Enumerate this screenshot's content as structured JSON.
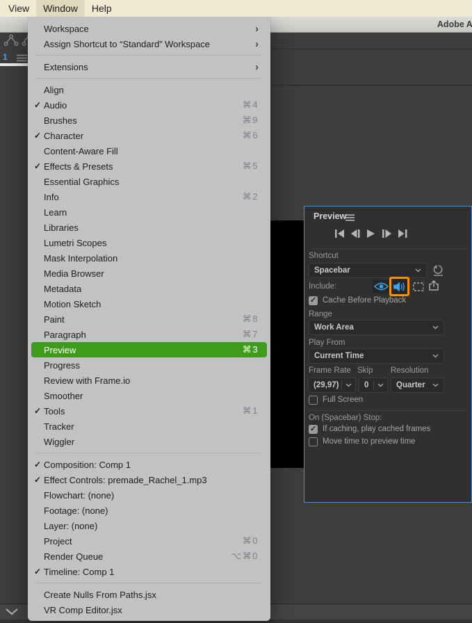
{
  "colors": {
    "menu_highlight_green": "#3f9c1a",
    "accent_blue": "#3ba1e8",
    "include_highlight_orange": "#f79400",
    "panel_border_blue": "#4590d8",
    "menubar_cream": "#f0ead2"
  },
  "menubar": {
    "items": [
      {
        "label": "View"
      },
      {
        "label": "Window",
        "active": true
      },
      {
        "label": "Help"
      }
    ]
  },
  "titlebar": {
    "title": "Adobe Af"
  },
  "background": {
    "timeline_tab_number": "1"
  },
  "window_menu": {
    "items": [
      {
        "label": "Workspace",
        "submenu": true
      },
      {
        "label": "Assign Shortcut to “Standard” Workspace",
        "submenu": true
      },
      {
        "separator": true
      },
      {
        "label": "Extensions",
        "submenu": true
      },
      {
        "separator": true
      },
      {
        "label": "Align"
      },
      {
        "label": "Audio",
        "checked": true,
        "shortcut": "⌘4"
      },
      {
        "label": "Brushes",
        "shortcut": "⌘9"
      },
      {
        "label": "Character",
        "checked": true,
        "shortcut": "⌘6"
      },
      {
        "label": "Content-Aware Fill"
      },
      {
        "label": "Effects & Presets",
        "checked": true,
        "shortcut": "⌘5"
      },
      {
        "label": "Essential Graphics"
      },
      {
        "label": "Info",
        "shortcut": "⌘2"
      },
      {
        "label": "Learn"
      },
      {
        "label": "Libraries"
      },
      {
        "label": "Lumetri Scopes"
      },
      {
        "label": "Mask Interpolation"
      },
      {
        "label": "Media Browser"
      },
      {
        "label": "Metadata"
      },
      {
        "label": "Motion Sketch"
      },
      {
        "label": "Paint",
        "shortcut": "⌘8"
      },
      {
        "label": "Paragraph",
        "shortcut": "⌘7"
      },
      {
        "label": "Preview",
        "shortcut": "⌘3",
        "highlighted": true
      },
      {
        "label": "Progress"
      },
      {
        "label": "Review with Frame.io"
      },
      {
        "label": "Smoother"
      },
      {
        "label": "Tools",
        "checked": true,
        "shortcut": "⌘1"
      },
      {
        "label": "Tracker"
      },
      {
        "label": "Wiggler"
      },
      {
        "separator": true
      },
      {
        "label": "Composition: Comp 1",
        "checked": true
      },
      {
        "label": "Effect Controls: premade_Rachel_1.mp3",
        "checked": true
      },
      {
        "label": "Flowchart: (none)"
      },
      {
        "label": "Footage: (none)"
      },
      {
        "label": "Layer: (none)"
      },
      {
        "label": "Project",
        "shortcut": "⌘0"
      },
      {
        "label": "Render Queue",
        "shortcut": "⌥⌘0"
      },
      {
        "label": "Timeline: Comp 1",
        "checked": true
      },
      {
        "separator": true
      },
      {
        "label": "Create Nulls From Paths.jsx"
      },
      {
        "label": "VR Comp Editor.jsx"
      }
    ]
  },
  "preview_panel": {
    "title": "Preview",
    "transport_icons": [
      "first-frame",
      "previous-frame",
      "play",
      "next-frame",
      "last-frame"
    ],
    "include_icons": [
      "video-eye",
      "audio-speaker",
      "overlays"
    ],
    "labels": {
      "shortcut": "Shortcut",
      "include": "Include:",
      "range": "Range",
      "play_from": "Play From",
      "frame_rate": "Frame Rate",
      "skip": "Skip",
      "resolution": "Resolution",
      "on_stop": "On (Spacebar) Stop:"
    },
    "dropdowns": {
      "shortcut": "Spacebar",
      "range": "Work Area",
      "play_from": "Current Time",
      "frame_rate": "(29,97)",
      "skip": "0",
      "resolution": "Quarter"
    },
    "checkboxes": [
      {
        "label": "Cache Before Playback",
        "checked": true
      },
      {
        "label": "Full Screen",
        "checked": false
      },
      {
        "label": "If caching, play cached frames",
        "checked": true
      },
      {
        "label": "Move time to preview time",
        "checked": false
      }
    ]
  }
}
